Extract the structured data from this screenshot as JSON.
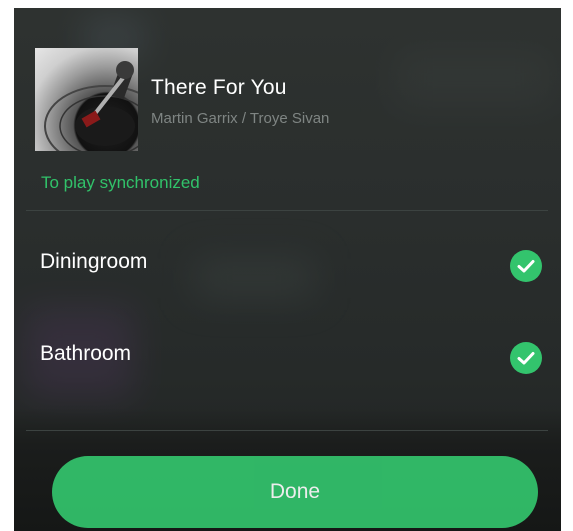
{
  "track": {
    "title": "There For You",
    "artist": "Martin Garrix / Troye Sivan"
  },
  "sync": {
    "label": "To play synchronized"
  },
  "rooms": [
    {
      "name": "Diningroom",
      "selected": true,
      "icon": "check-circle-icon"
    },
    {
      "name": "Bathroom",
      "selected": true,
      "icon": "check-circle-icon"
    }
  ],
  "actions": {
    "done_label": "Done"
  },
  "colors": {
    "accent": "#33c46d",
    "background": "#2a2e2d",
    "text_primary": "#ffffff",
    "text_secondary": "#7f8583"
  }
}
